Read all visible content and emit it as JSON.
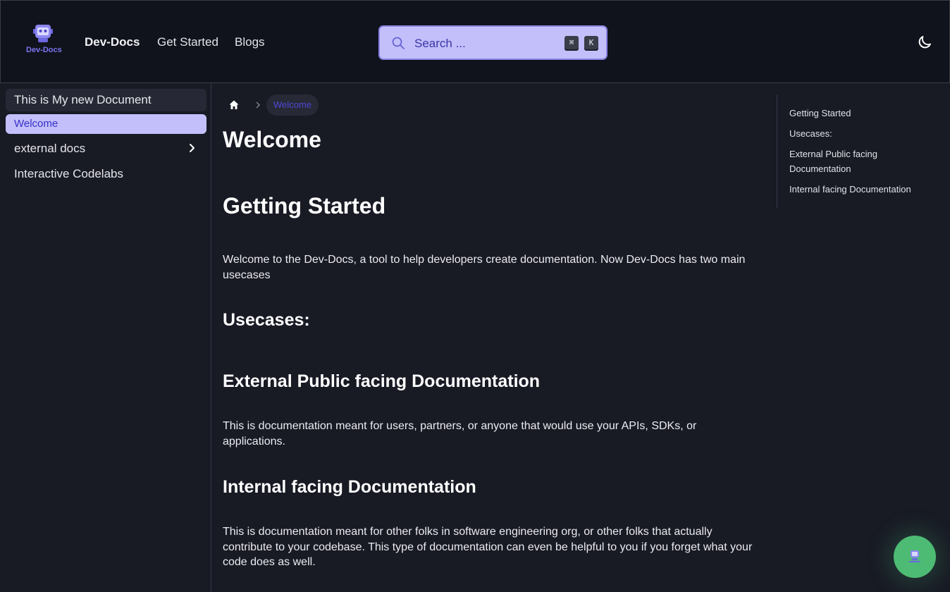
{
  "header": {
    "logo_text": "Dev-Docs",
    "brand": "Dev-Docs",
    "nav": [
      "Get Started",
      "Blogs"
    ],
    "search": {
      "placeholder": "Search ...",
      "shortcut_keys": [
        "⌘",
        "K"
      ]
    },
    "theme_icon": "moon-icon"
  },
  "sidebar": {
    "title": "This is My new Document",
    "items": [
      {
        "label": "Welcome",
        "active": true
      },
      {
        "label": "external docs",
        "expandable": true
      },
      {
        "label": "Interactive Codelabs"
      }
    ]
  },
  "breadcrumb": {
    "home_icon": "home-icon",
    "current": "Welcome"
  },
  "main": {
    "title": "Welcome",
    "getting_started_heading": "Getting Started",
    "intro": "Welcome to the Dev-Docs, a tool to help developers create documentation. Now Dev-Docs has two main usecases",
    "usecases_heading": "Usecases:",
    "external_heading": "External Public facing Documentation",
    "external_text": "This is documentation meant for users, partners, or anyone that would use your APIs, SDKs, or applications.",
    "internal_heading": "Internal facing Documentation",
    "internal_text": "This is documentation meant for other folks in software engineering org, or other folks that actually contribute to your codebase. This type of documentation can even be helpful to you if you forget what your code does as well."
  },
  "toc": [
    "Getting Started",
    "Usecases:",
    "External Public facing Documentation",
    "Internal facing Documentation"
  ],
  "colors": {
    "background": "#181a24",
    "navbar": "#10131c",
    "accent": "#c2bffa",
    "accent_text": "#3730c9",
    "fab": "#4dbb73"
  }
}
